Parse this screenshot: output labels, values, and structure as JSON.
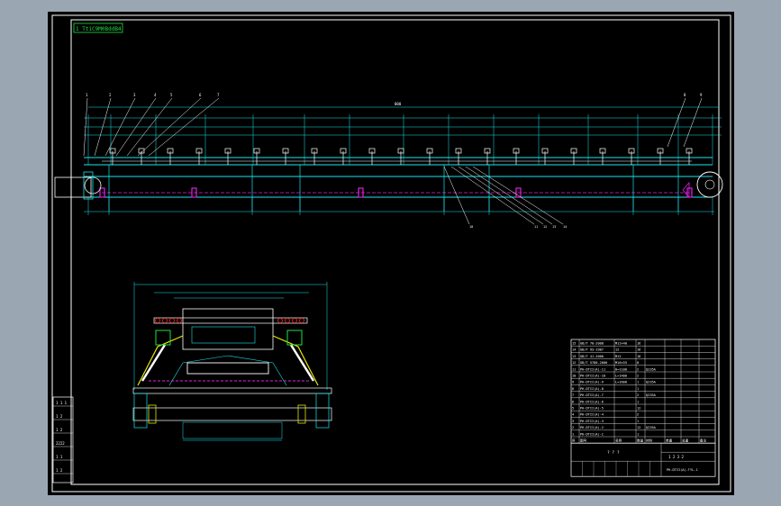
{
  "colors": {
    "background": "#000000",
    "chrome": "#9aa6b2",
    "cyan": "#19e6ee",
    "white": "#ffffff",
    "magenta": "#e020e0",
    "yellow": "#e6e600",
    "green": "#22e044",
    "red": "#e02020"
  },
  "title_stamp": "1 TtiC9M0BddB4",
  "elevation": {
    "overall_dim": "000",
    "left_callouts": [
      "1",
      "2",
      "3",
      "4",
      "5",
      "6",
      "7"
    ],
    "right_callouts": [
      "8",
      "9"
    ],
    "bottom_callouts": [
      "10",
      "11",
      "12",
      "13",
      "14"
    ]
  },
  "left_revision_block": [
    "1 1 1",
    "1 2",
    "1 2",
    "2222",
    "1 1",
    "1 2"
  ],
  "parts_table": {
    "rows": [
      [
        "15",
        "GB/T 70-2008",
        "M12×40",
        "16",
        "",
        "",
        "",
        ""
      ],
      [
        "14",
        "GB/T 93-1987",
        "12",
        "16",
        "",
        "",
        "",
        ""
      ],
      [
        "13",
        "GB/T 41-2000",
        "M12",
        "16",
        "",
        "",
        "",
        ""
      ],
      [
        "12",
        "GB/T 5780-2000",
        "M16×55",
        "8",
        "",
        "",
        "",
        ""
      ],
      [
        "11",
        "PH-DTII(A)-11",
        "H=1100",
        "2",
        "Q235A",
        "",
        "",
        ""
      ],
      [
        "10",
        "PH-DTII(A)-10",
        "L=1400",
        "2",
        "",
        "",
        "",
        ""
      ],
      [
        "9",
        "PH-DTII(A)-9",
        "L=1600",
        "1",
        "Q235A",
        "",
        "",
        ""
      ],
      [
        "8",
        "PH-DTII(A)-8",
        "",
        "1",
        "",
        "",
        "",
        ""
      ],
      [
        "7",
        "PH-DTII(A)-7",
        "",
        "2",
        "Q235A",
        "",
        "",
        ""
      ],
      [
        "6",
        "PH-DTII(A)-6",
        "",
        "1",
        "",
        "",
        "",
        ""
      ],
      [
        "5",
        "PH-DTII(A)-5",
        "",
        "12",
        "",
        "",
        "",
        ""
      ],
      [
        "4",
        "PH-DTII(A)-4",
        "",
        "2",
        "",
        "",
        "",
        ""
      ],
      [
        "3",
        "PH-DTII(A)-3",
        "",
        "1",
        "",
        "",
        "",
        ""
      ],
      [
        "2",
        "PH-DTII(A)-2",
        "",
        "12",
        "Q235A",
        "",
        "",
        ""
      ],
      [
        "1",
        "PH-DTII(A)-1",
        "",
        "1",
        "",
        "",
        "",
        ""
      ]
    ],
    "header": [
      "序",
      "图号",
      "名称",
      "数量",
      "材料",
      "单重",
      "总重",
      "备注"
    ],
    "title_cell": "? ? ?",
    "drawing_no": "1 2 3 2",
    "company": "PH-DTII(A)-TYL-1"
  }
}
